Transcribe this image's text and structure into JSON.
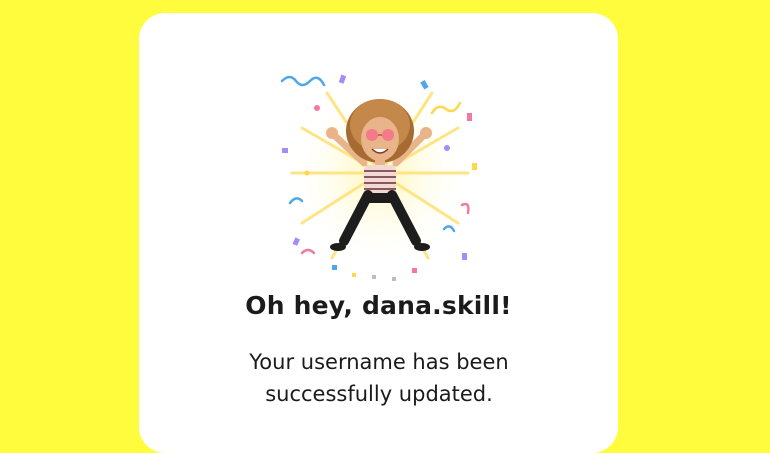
{
  "dialog": {
    "greeting": "Oh hey, dana.skill!",
    "message": "Your username has been successfully updated."
  },
  "illustration": {
    "name": "bitmoji-celebration"
  },
  "colors": {
    "background": "#FFFC3D",
    "card": "#FFFFFF",
    "text": "#1B1B1B"
  }
}
